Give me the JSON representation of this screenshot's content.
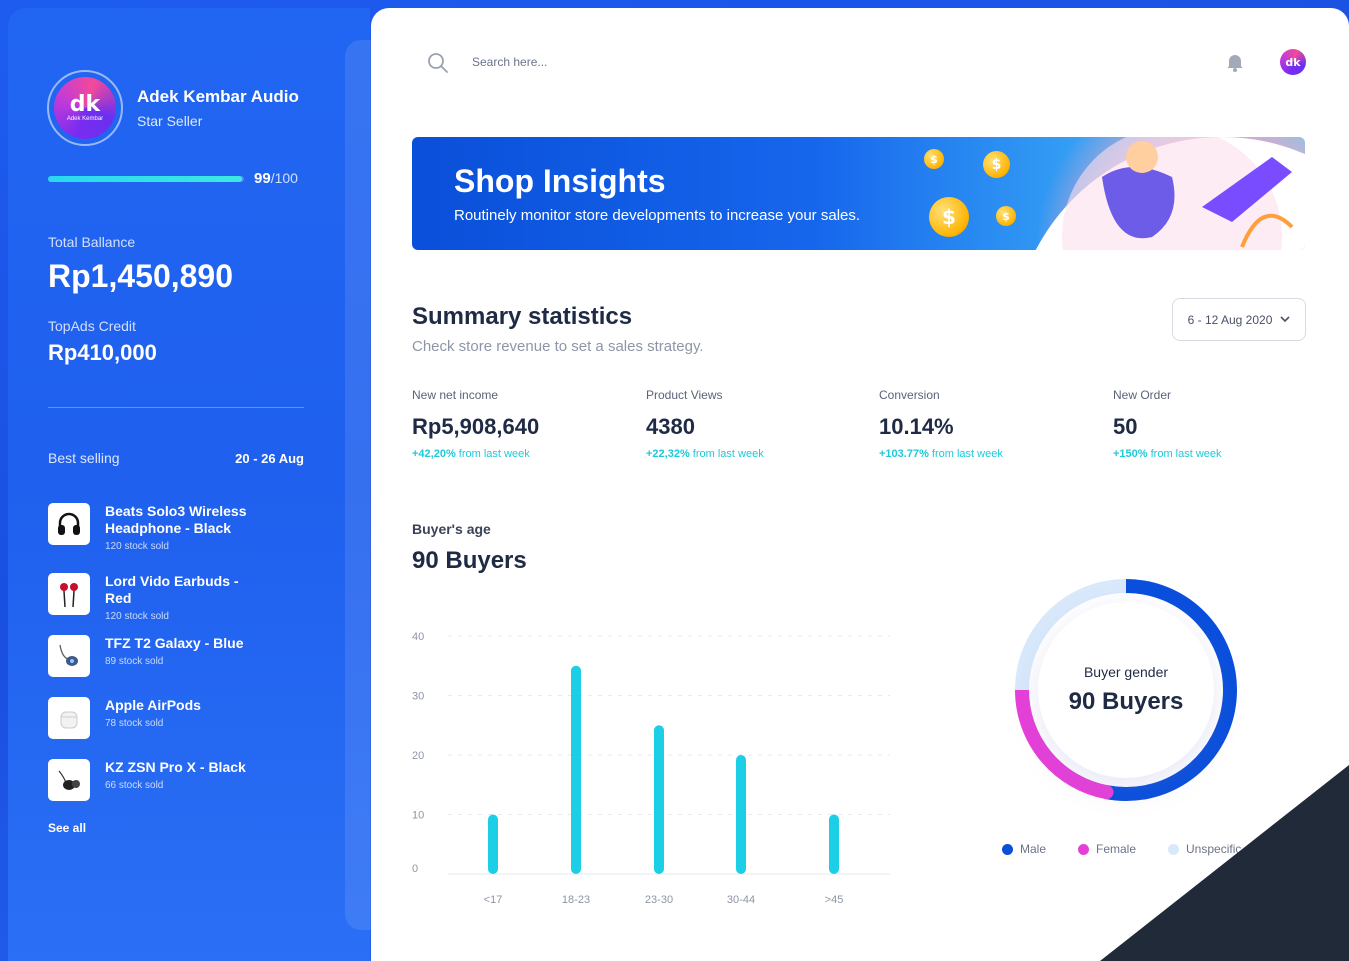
{
  "sidebar": {
    "store_name": "Adek Kembar Audio",
    "store_tier": "Star Seller",
    "avatar_logo": "dk",
    "avatar_caption": "Adek Kembar",
    "score": {
      "value": "99",
      "max": "/100",
      "fraction": 0.99
    },
    "balance_label": "Total Ballance",
    "balance_value": "Rp1,450,890",
    "credit_label": "TopAds Credit",
    "credit_value": "Rp410,000",
    "best_selling_label": "Best selling",
    "best_selling_range": "20 - 26 Aug",
    "products": [
      {
        "name": "Beats Solo3 Wireless Headphone - Black",
        "sold": "120 stock sold",
        "icon": "headphone-icon"
      },
      {
        "name": "Lord Vido Earbuds - Red",
        "sold": "120 stock sold",
        "icon": "earbuds-icon"
      },
      {
        "name": "TFZ T2 Galaxy - Blue",
        "sold": "89 stock sold",
        "icon": "in-ear-monitor-icon"
      },
      {
        "name": "Apple AirPods",
        "sold": "78 stock sold",
        "icon": "airpods-icon"
      },
      {
        "name": "KZ ZSN Pro X - Black",
        "sold": "66 stock sold",
        "icon": "in-ear-monitor-icon"
      }
    ],
    "see_all": "See all"
  },
  "header": {
    "search_placeholder": "Search here...",
    "avatar_logo": "dk"
  },
  "banner": {
    "title": "Shop Insights",
    "subtitle": "Routinely monitor store developments to increase your sales.",
    "coin_symbol": "$"
  },
  "summary": {
    "title": "Summary statistics",
    "subtitle": "Check store revenue to set a sales strategy.",
    "date_range": "6 - 12 Aug 2020",
    "stats": [
      {
        "label": "New net income",
        "value": "Rp5,908,640",
        "change": "+42,20%",
        "suffix": " from last week"
      },
      {
        "label": "Product Views",
        "value": "4380",
        "change": "+22,32%",
        "suffix": " from last week"
      },
      {
        "label": "Conversion",
        "value": "10.14%",
        "change": "+103.77%",
        "suffix": " from last week"
      },
      {
        "label": "New Order",
        "value": "50",
        "change": "+150%",
        "suffix": " from last week"
      }
    ]
  },
  "buyer_age": {
    "label": "Buyer's age",
    "value": "90 Buyers"
  },
  "buyer_gender": {
    "label": "Buyer gender",
    "value": "90 Buyers",
    "legend": [
      {
        "name": "Male",
        "color": "#0a4fdc"
      },
      {
        "name": "Female",
        "color": "#e63fd8"
      },
      {
        "name": "Unspecific",
        "color": "#d9e9fb"
      }
    ],
    "fractions": {
      "male": 0.53,
      "female": 0.22,
      "unspecific": 0.25
    }
  },
  "chart_data": [
    {
      "type": "bar",
      "title": "",
      "categories": [
        "<17",
        "18-23",
        "23-30",
        "30-44",
        ">45"
      ],
      "values": [
        10,
        35,
        25,
        20,
        10
      ],
      "yticks": [
        0,
        10,
        20,
        30,
        40
      ],
      "ylim": [
        0,
        40
      ],
      "xlabel": "",
      "ylabel": "",
      "grid": true,
      "color": "#1ccfe6"
    },
    {
      "type": "pie",
      "title": "",
      "categories": [
        "Male",
        "Female",
        "Unspecific"
      ],
      "values": [
        0.53,
        0.22,
        0.25
      ],
      "colors": [
        "#0a4fdc",
        "#e63fd8",
        "#d9e9fb"
      ]
    }
  ]
}
